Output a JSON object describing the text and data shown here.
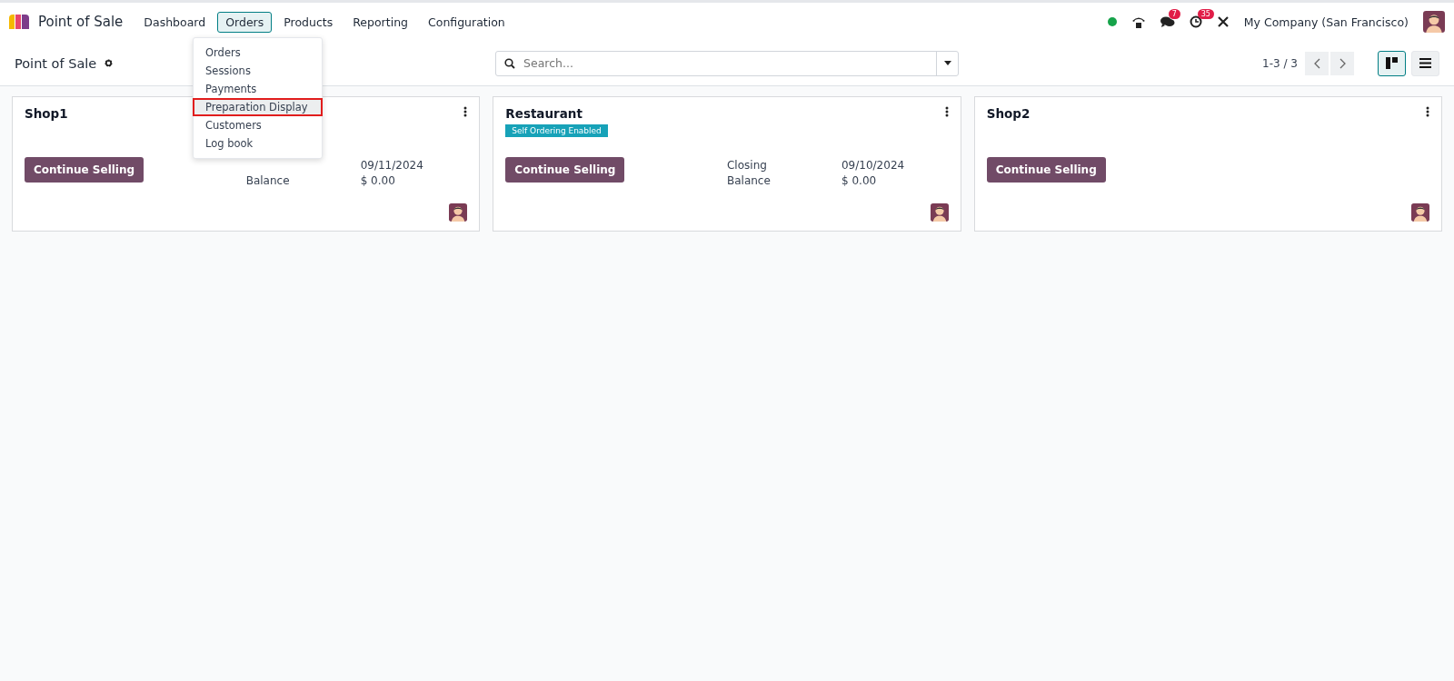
{
  "navbar": {
    "app_name": "Point of Sale",
    "menus": [
      {
        "label": "Dashboard",
        "selected": false
      },
      {
        "label": "Orders",
        "selected": true
      },
      {
        "label": "Products",
        "selected": false
      },
      {
        "label": "Reporting",
        "selected": false
      },
      {
        "label": "Configuration",
        "selected": false
      }
    ],
    "systray": {
      "chat_badge": "7",
      "activity_badge": "35",
      "company": "My Company (San Francisco)"
    }
  },
  "dropdown": {
    "items": [
      {
        "label": "Orders",
        "selected": false
      },
      {
        "label": "Sessions",
        "selected": false
      },
      {
        "label": "Payments",
        "selected": false
      },
      {
        "label": "Preparation Display",
        "selected": true
      },
      {
        "label": "Customers",
        "selected": false
      },
      {
        "label": "Log book",
        "selected": false
      }
    ]
  },
  "control_panel": {
    "title": "Point of Sale",
    "search": {
      "placeholder": "Search..."
    },
    "pager": "1-3 / 3",
    "views": [
      {
        "kind": "kanban",
        "selected": true
      },
      {
        "kind": "list",
        "selected": false
      }
    ]
  },
  "cards": [
    {
      "name": "Shop1",
      "button": "Continue Selling",
      "stats": [
        {
          "value": "09/11/2024"
        },
        {
          "label": "Balance",
          "value": "$ 0.00"
        }
      ]
    },
    {
      "name": "Restaurant",
      "tag": "Self Ordering Enabled",
      "button": "Continue Selling",
      "stats": [
        {
          "label": "Closing",
          "value": "09/10/2024"
        },
        {
          "label": "Balance",
          "value": "$ 0.00"
        }
      ]
    },
    {
      "name": "Shop2",
      "button": "Continue Selling"
    }
  ]
}
